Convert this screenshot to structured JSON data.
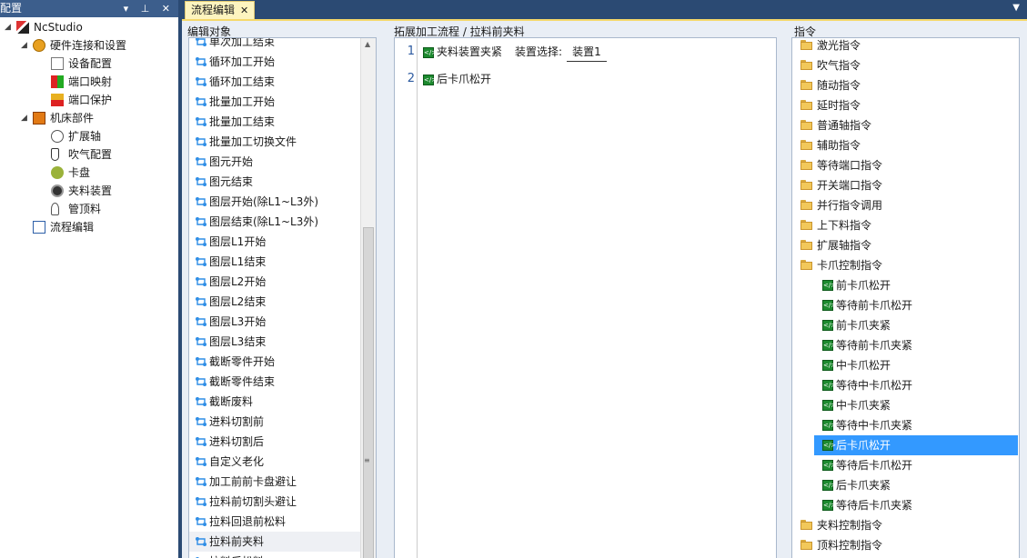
{
  "config_panel": {
    "title": "配置",
    "buttons": "▾ ⊥ ✕",
    "tree": [
      {
        "label": "NcStudio",
        "level": 0,
        "expander": "◢",
        "icon": "ncstudio-icon"
      },
      {
        "label": "硬件连接和设置",
        "level": 1,
        "expander": "◢",
        "icon": "hardware-icon"
      },
      {
        "label": "设备配置",
        "level": 2,
        "icon": "device-config-icon"
      },
      {
        "label": "端口映射",
        "level": 2,
        "icon": "port-map-icon"
      },
      {
        "label": "端口保护",
        "level": 2,
        "icon": "port-protect-icon"
      },
      {
        "label": "机床部件",
        "level": 1,
        "expander": "◢",
        "icon": "machine-parts-icon"
      },
      {
        "label": "扩展轴",
        "level": 2,
        "icon": "extend-axis-icon"
      },
      {
        "label": "吹气配置",
        "level": 2,
        "icon": "blow-icon"
      },
      {
        "label": "卡盘",
        "level": 2,
        "icon": "chuck-icon"
      },
      {
        "label": "夹料装置",
        "level": 2,
        "icon": "clamp-icon"
      },
      {
        "label": "管顶料",
        "level": 2,
        "icon": "pipe-top-icon"
      },
      {
        "label": "流程编辑",
        "level": 1,
        "icon": "edit-icon"
      }
    ]
  },
  "tab": {
    "label": "流程编辑",
    "close": "✕"
  },
  "dropdown": "▼",
  "edit_objects": {
    "title": "编辑对象",
    "items": [
      "单次加工结束",
      "循环加工开始",
      "循环加工结束",
      "批量加工开始",
      "批量加工结束",
      "批量加工切换文件",
      "图元开始",
      "图元结束",
      "图层开始(除L1~L3外)",
      "图层结束(除L1~L3外)",
      "图层L1开始",
      "图层L1结束",
      "图层L2开始",
      "图层L2结束",
      "图层L3开始",
      "图层L3结束",
      "截断零件开始",
      "截断零件结束",
      "截断废料",
      "进料切割前",
      "进料切割后",
      "自定义老化",
      "加工前前卡盘避让",
      "拉料前切割头避让",
      "拉料回退前松料",
      "拉料前夹料",
      "拉料后松料"
    ],
    "selected_index": 25
  },
  "flow_editor": {
    "title": "拓展加工流程 / 拉料前夹料",
    "lines": [
      {
        "num": "1",
        "stmt": "夹料装置夹紧",
        "param_label": "装置选择:",
        "param_value": "装置1"
      },
      {
        "num": "2",
        "stmt": "后卡爪松开"
      }
    ]
  },
  "instructions": {
    "title": "指令",
    "groups": [
      "激光指令",
      "吹气指令",
      "随动指令",
      "延时指令",
      "普通轴指令",
      "辅助指令",
      "等待端口指令",
      "开关端口指令",
      "并行指令调用",
      "上下料指令",
      "扩展轴指令"
    ],
    "open_group": "卡爪控制指令",
    "children": [
      "前卡爪松开",
      "等待前卡爪松开",
      "前卡爪夹紧",
      "等待前卡爪夹紧",
      "中卡爪松开",
      "等待中卡爪松开",
      "中卡爪夹紧",
      "等待中卡爪夹紧",
      "后卡爪松开",
      "等待后卡爪松开",
      "后卡爪夹紧",
      "等待后卡爪夹紧"
    ],
    "selected_child": 8,
    "after_groups": [
      "夹料控制指令",
      "顶料控制指令"
    ]
  }
}
